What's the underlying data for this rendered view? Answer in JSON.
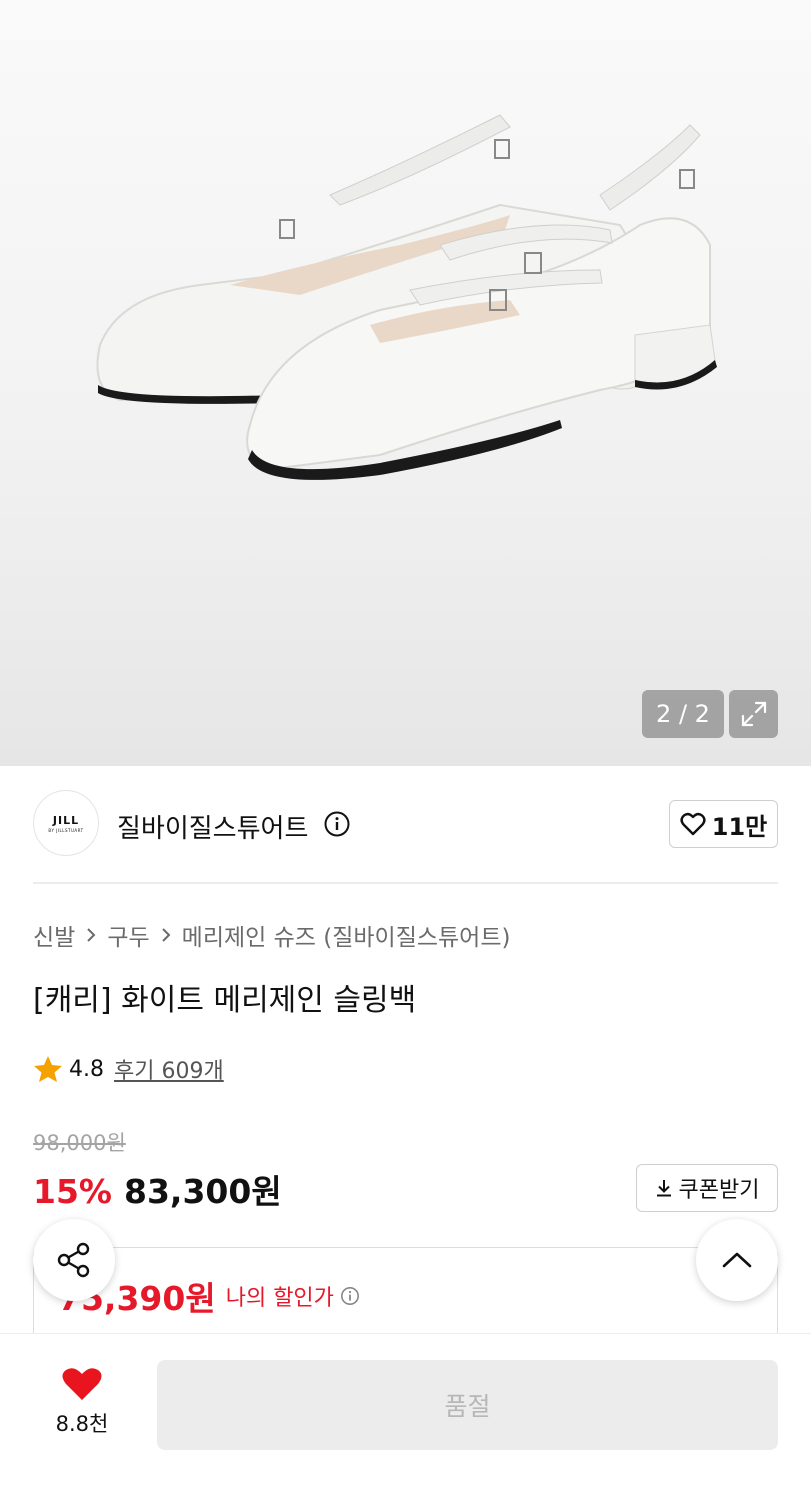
{
  "gallery": {
    "counter": "2 / 2",
    "expand_icon": "expand-icon",
    "image_alt": "white mary jane slingback shoes"
  },
  "brand": {
    "logo_line1": "JILL",
    "logo_line2": "BY JILLSTUART",
    "name": "질바이질스튜어트",
    "info_icon": "info-icon",
    "like_count": "11만"
  },
  "breadcrumb": {
    "items": [
      "신발",
      "구두",
      "메리제인 슈즈 (질바이질스튜어트)"
    ]
  },
  "product": {
    "title": "[캐리] 화이트 메리제인 슬링백",
    "rating": "4.8",
    "reviews": "후기 609개",
    "original_price": "98,000원",
    "discount": "15%",
    "price": "83,300원",
    "coupon_label": "쿠폰받기",
    "my_price": "75,390원",
    "my_price_label": "나의 할인가"
  },
  "bottom": {
    "wish_count": "8.8천",
    "soldout_label": "품절"
  },
  "colors": {
    "accent_red": "#e6192b",
    "star": "#f5a100",
    "heart": "#e8151f"
  }
}
